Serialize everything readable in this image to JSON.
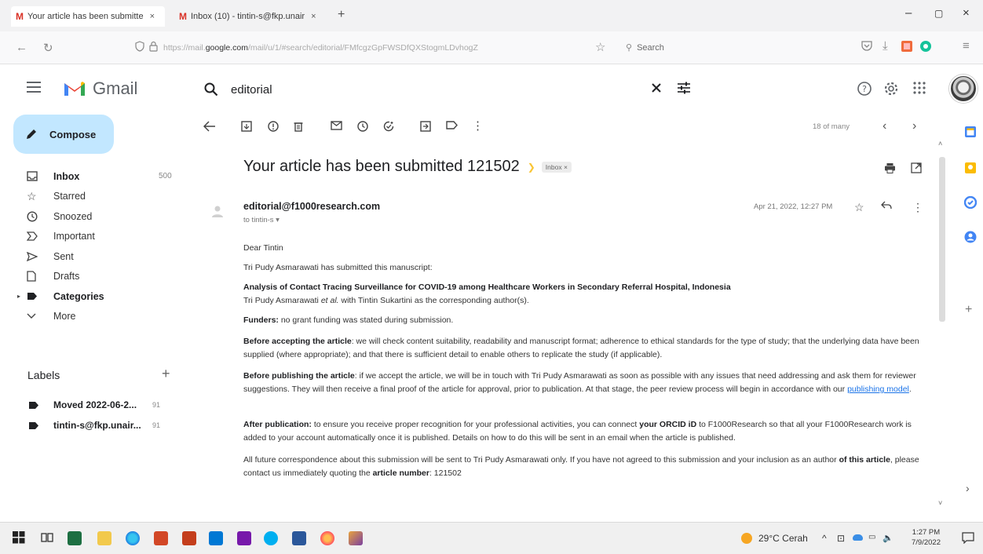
{
  "browser": {
    "tabs": [
      {
        "favicon": "M",
        "label": "Your article has been submitte",
        "close": "×"
      },
      {
        "favicon": "M",
        "label": "Inbox (10) - tintin-s@fkp.unair",
        "close": "×"
      }
    ],
    "new_tab": "+",
    "window_controls": {
      "minimize": "–",
      "maximize": "▢",
      "close": "×"
    },
    "url_prefix": "https://mail.",
    "url_domain": "google.com",
    "url_rest": "/mail/u/1/#search/editorial/FMfcgzGpFWSDfQXStogmLDvhogZ",
    "search_placeholder": "Search"
  },
  "gmail": {
    "logo_text": "Gmail",
    "search_value": "editorial",
    "compose_label": "Compose",
    "nav": [
      {
        "label": "Inbox",
        "count": "500",
        "icon": "inbox-icon",
        "bold": true
      },
      {
        "label": "Starred",
        "count": "",
        "icon": "star-icon",
        "bold": false
      },
      {
        "label": "Snoozed",
        "count": "",
        "icon": "clock-icon",
        "bold": false
      },
      {
        "label": "Important",
        "count": "",
        "icon": "important-icon",
        "bold": false
      },
      {
        "label": "Sent",
        "count": "",
        "icon": "send-icon",
        "bold": false
      },
      {
        "label": "Drafts",
        "count": "",
        "icon": "draft-icon",
        "bold": false
      },
      {
        "label": "Categories",
        "count": "",
        "icon": "label-icon",
        "bold": true
      },
      {
        "label": "More",
        "count": "",
        "icon": "chevron-down-icon",
        "bold": false
      }
    ],
    "labels_heading": "Labels",
    "labels_add": "+",
    "labels": [
      {
        "label": "Moved 2022-06-2...",
        "count": "91"
      },
      {
        "label": "tintin-s@fkp.unair...",
        "count": "91"
      }
    ],
    "pager": "18 of many",
    "subject": "Your article has been submitted 121502",
    "inbox_badge": "Inbox ×",
    "sender": "editorial@f1000research.com",
    "to": "to tintin-s ▾",
    "date": "Apr 21, 2022, 12:27 PM",
    "body": {
      "greeting": "Dear Tintin",
      "line1": "Tri Pudy Asmarawati has submitted this manuscript:",
      "title": "Analysis of Contact Tracing Surveillance for COVID-19 among Healthcare Workers in Secondary Referral Hospital, Indonesia",
      "authors_a": "Tri Pudy Asmarawati ",
      "authors_etal": "et al.",
      "authors_b": " with Tintin Sukartini as the corresponding author(s).",
      "funders_label": "Funders:",
      "funders_text": " no grant funding was stated during submission.",
      "before_accept_label": "Before accepting the article",
      "before_accept_text": ": we will check content suitability, readability and manuscript format; adherence to ethical standards for the type of study; that the underlying data have been supplied (where appropriate); and that there is sufficient detail to enable others to replicate the study (if applicable).",
      "before_publish_label": "Before publishing the article",
      "before_publish_text": ": if we accept the article, we will be in touch with Tri Pudy Asmarawati as soon as possible with any issues that need addressing and ask them for reviewer suggestions. They will then receive a final proof of the article for approval, prior to publication. At that stage, the peer review process will begin in accordance with our ",
      "publishing_model_link": "publishing model",
      "after_pub_label": "After publication:",
      "after_pub_text_a": " to ensure you receive proper recognition for your professional activities, you can connect ",
      "after_pub_orcid": "your ORCID iD",
      "after_pub_text_b": " to F1000Research so that all your F1000Research work is added to your account automatically once it is published. Details on how to do this will be sent in an email when the article is published.",
      "future_text_a": "All future correspondence about this submission will be sent to Tri Pudy Asmarawati only. If you have not agreed to this submission and your inclusion as an author ",
      "future_bold": "of this article",
      "future_text_b": ", please contact us immediately quoting the ",
      "article_number_label": "article number",
      "article_number": ": 121502"
    }
  },
  "taskbar": {
    "weather": "29°C Cerah",
    "time": "1:27 PM",
    "date": "7/9/2022"
  },
  "colors": {
    "compose_bg": "#c2e7ff",
    "gmail_red": "#ea4335",
    "link": "#1a73e8"
  }
}
